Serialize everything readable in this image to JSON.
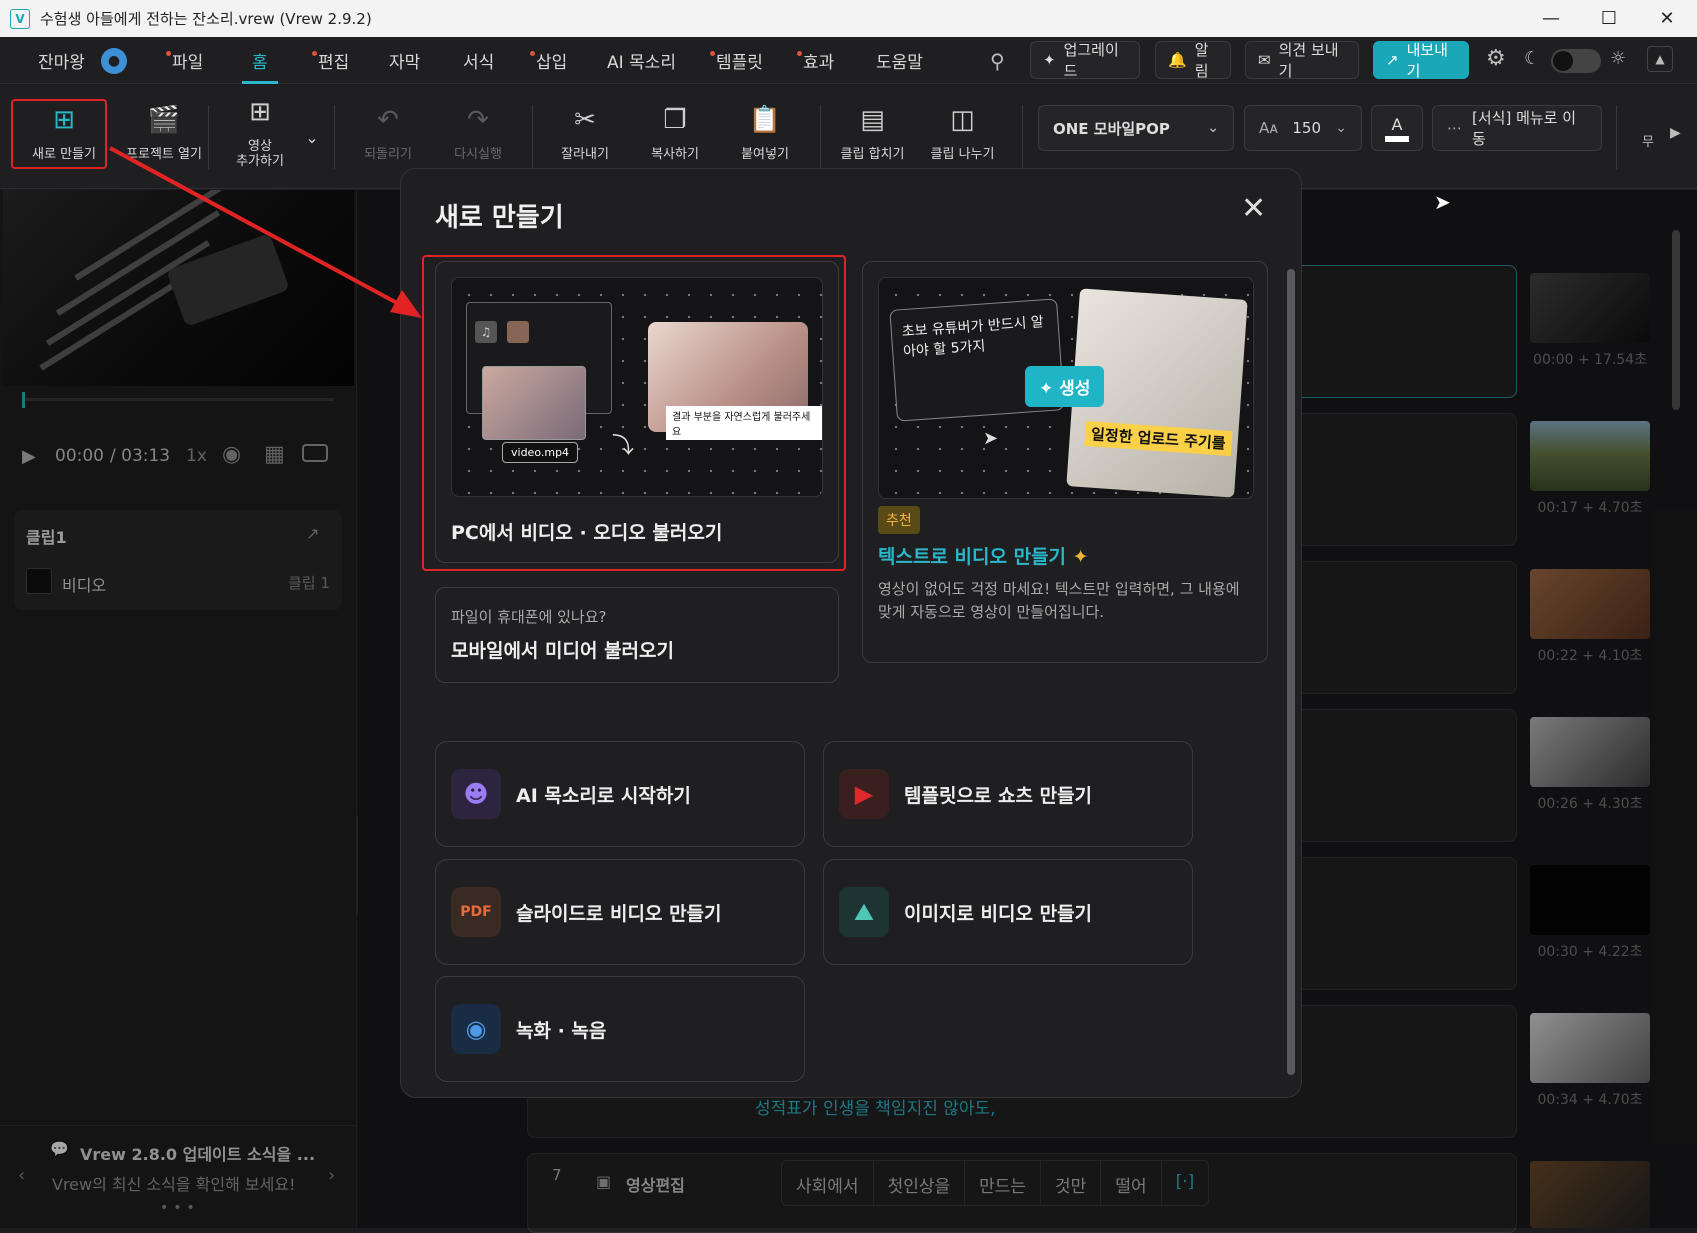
{
  "window": {
    "title": "수험생 아들에게 전하는 잔소리.vrew (Vrew 2.9.2)",
    "app_icon": "V"
  },
  "menubar": {
    "user": "잔마왕",
    "items": [
      {
        "label": "파일",
        "dot": true
      },
      {
        "label": "홈",
        "dot": false,
        "active": true
      },
      {
        "label": "편집",
        "dot": true
      },
      {
        "label": "자막",
        "dot": false
      },
      {
        "label": "서식",
        "dot": false
      },
      {
        "label": "삽입",
        "dot": true
      },
      {
        "label": "AI 목소리",
        "dot": false
      },
      {
        "label": "템플릿",
        "dot": true
      },
      {
        "label": "효과",
        "dot": true
      },
      {
        "label": "도움말",
        "dot": false
      }
    ],
    "upgrade": "업그레이드",
    "notifications": "알림",
    "feedback": "의견 보내기",
    "export": "내보내기"
  },
  "toolbar": {
    "new": "새로 만들기",
    "open": "프로젝트 열기",
    "add_video_1": "영상",
    "add_video_2": "추가하기",
    "undo": "되돌리기",
    "redo": "다시실행",
    "cut": "잘라내기",
    "copy": "복사하기",
    "paste": "붙여넣기",
    "merge": "클립 합치기",
    "split": "클립 나누기",
    "font": "ONE 모바일POP",
    "font_size": "150",
    "format_menu": "[서식] 메뉴로 이동",
    "more": "무"
  },
  "player": {
    "current": "00:00",
    "total": "/ 03:13",
    "speed": "1x"
  },
  "clip_panel": {
    "title": "클립1",
    "item": "비디오",
    "item_tag": "클립 1"
  },
  "news": {
    "title": "Vrew 2.8.0 업데이트 소식을 ...",
    "subtitle": "Vrew의 최신 소식을 확인해 보세요!"
  },
  "editor": {
    "timecodes": [
      "00:00 + 17.54초",
      "00:17 + 4.70초",
      "00:22 + 4.10초",
      "00:26 + 4.30초",
      "00:30 + 4.22초",
      "00:34 + 4.70초"
    ],
    "row6_text": "성적표가 인생을 책임지진 않아도,",
    "row7_num": "7",
    "row7_label": "영상편집",
    "row7_words": [
      "사회에서",
      "첫인상을",
      "만드는",
      "것만",
      "떨어",
      "[·]"
    ]
  },
  "dialog": {
    "title": "새로 만들기",
    "pc_import": "PC에서 비디오 · 오디오 불러오기",
    "pc_illu_file": "video.mp4",
    "pc_illu_caption": "결과 부분을 자연스럽게 불러주세요",
    "mobile_hint": "파일이 휴대폰에 있나요?",
    "mobile_import": "모바일에서 미디어 불러오기",
    "text_illu_bubble": "초보 유튜버가 반드시 알아야 할 5가지",
    "text_illu_generate": "✦ 생성",
    "text_illu_caption": "일정한 업로드 주기를",
    "badge": "추천",
    "text_to_video": "텍스트로 비디오 만들기",
    "text_to_video_desc": "영상이 없어도 걱정 마세요! 텍스트만 입력하면, 그 내용에 맞게 자동으로 영상이 만들어집니다.",
    "options": [
      {
        "label": "AI 목소리로 시작하기",
        "icon": "voice-icon",
        "color": "#7a5cf0"
      },
      {
        "label": "템플릿으로 쇼츠 만들기",
        "icon": "shorts-icon",
        "color": "#d8232a"
      },
      {
        "label": "슬라이드로 비디오 만들기",
        "icon": "pdf-slide-icon",
        "color": "#e86c3c"
      },
      {
        "label": "이미지로 비디오 만들기",
        "icon": "image-icon",
        "color": "#3fb8a8"
      },
      {
        "label": "녹화 · 녹음",
        "icon": "webcam-icon",
        "color": "#2e7bd6"
      }
    ]
  }
}
